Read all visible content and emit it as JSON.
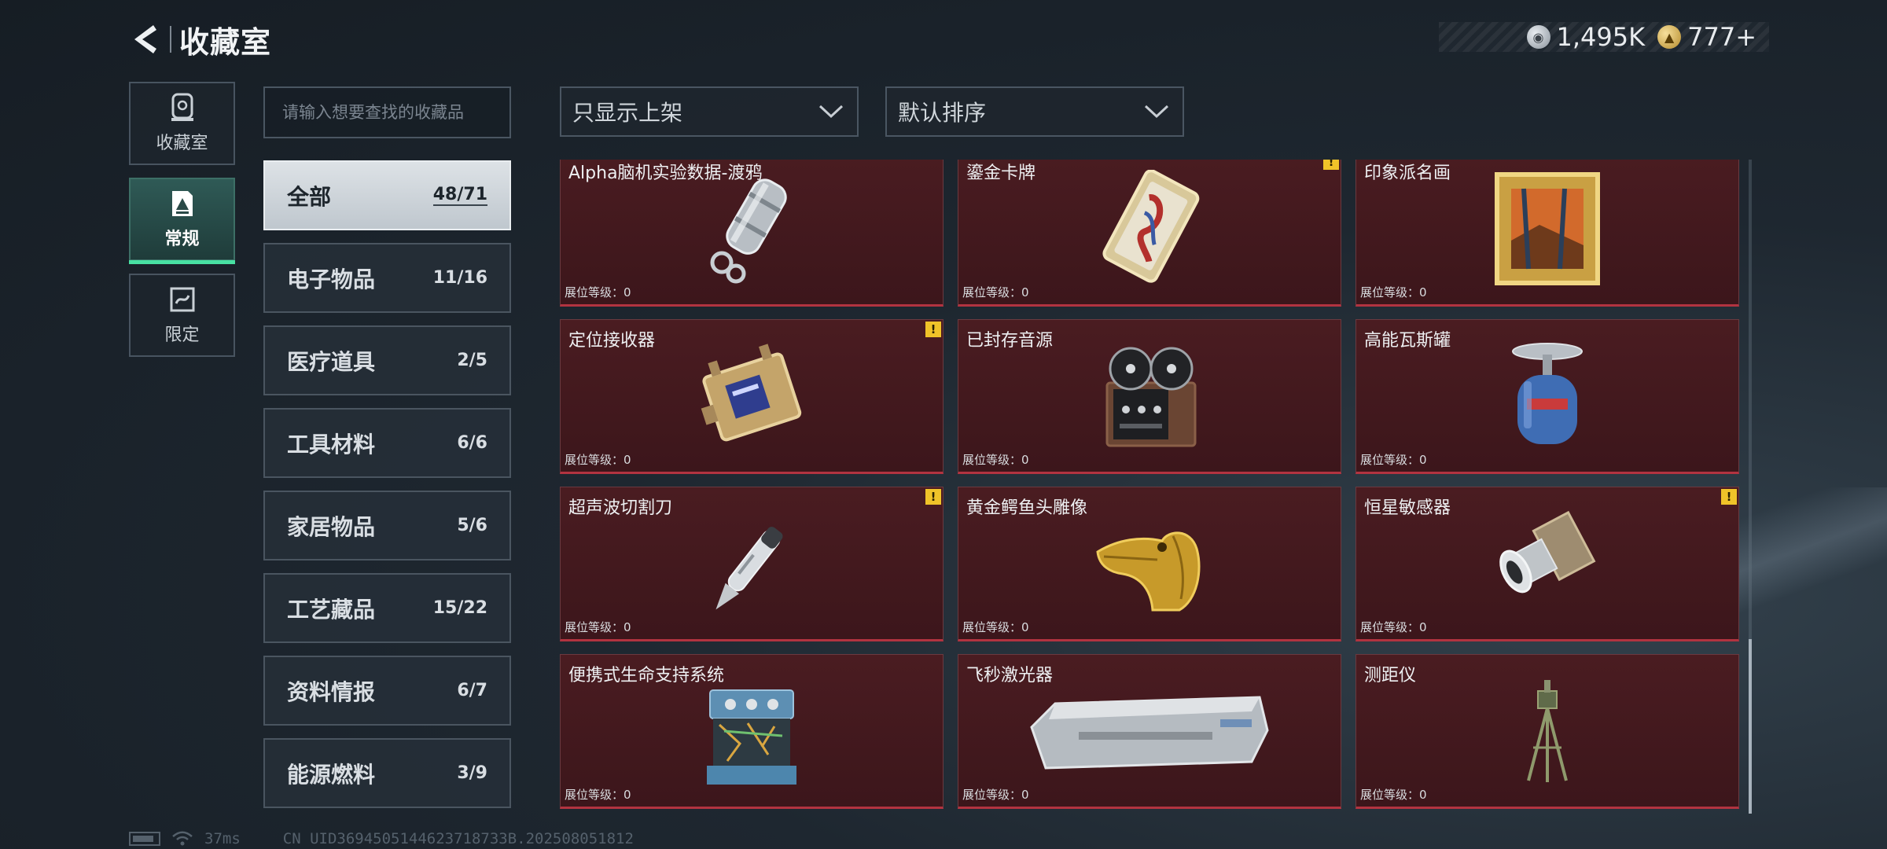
{
  "header": {
    "title": "收藏室"
  },
  "currency": [
    {
      "icon": "silver-coin-icon",
      "value": "1,495K"
    },
    {
      "icon": "gold-coin-icon",
      "value": "777+"
    }
  ],
  "left_nav": [
    {
      "label": "收藏室",
      "icon": "collection-room-icon",
      "active": false
    },
    {
      "label": "常规",
      "icon": "regular-items-icon",
      "active": true
    },
    {
      "label": "限定",
      "icon": "limited-items-icon",
      "active": false
    }
  ],
  "search": {
    "placeholder": "请输入想要查找的收藏品"
  },
  "categories": [
    {
      "name": "全部",
      "count": "48/71",
      "active": true
    },
    {
      "name": "电子物品",
      "count": "11/16"
    },
    {
      "name": "医疗道具",
      "count": "2/5"
    },
    {
      "name": "工具材料",
      "count": "6/6"
    },
    {
      "name": "家居物品",
      "count": "5/6"
    },
    {
      "name": "工艺藏品",
      "count": "15/22"
    },
    {
      "name": "资料情报",
      "count": "6/7"
    },
    {
      "name": "能源燃料",
      "count": "3/9"
    }
  ],
  "filters": {
    "shelf_filter": "只显示上架",
    "sort": "默认排序"
  },
  "items": [
    {
      "name": "Alpha脑机实验数据-渡鸦",
      "level": "展位等级：0",
      "warning": false,
      "art": "data-canister"
    },
    {
      "name": "鎏金卡牌",
      "level": "展位等级：0",
      "warning": true,
      "art": "gilded-card"
    },
    {
      "name": "印象派名画",
      "level": "展位等级：0",
      "warning": false,
      "art": "painting"
    },
    {
      "name": "定位接收器",
      "level": "展位等级：0",
      "warning": true,
      "art": "receiver"
    },
    {
      "name": "已封存音源",
      "level": "展位等级：0",
      "warning": false,
      "art": "tape-recorder"
    },
    {
      "name": "高能瓦斯罐",
      "level": "展位等级：0",
      "warning": false,
      "art": "gas-tank"
    },
    {
      "name": "超声波切割刀",
      "level": "展位等级：0",
      "warning": true,
      "art": "ultrasonic-knife"
    },
    {
      "name": "黄金鳄鱼头雕像",
      "level": "展位等级：0",
      "warning": false,
      "art": "croc-statue"
    },
    {
      "name": "恒星敏感器",
      "level": "展位等级：0",
      "warning": true,
      "art": "star-sensor"
    },
    {
      "name": "便携式生命支持系统",
      "level": "展位等级：0",
      "warning": false,
      "art": "life-support"
    },
    {
      "name": "飞秒激光器",
      "level": "展位等级：0",
      "warning": false,
      "art": "laser-case"
    },
    {
      "name": "测距仪",
      "level": "展位等级：0",
      "warning": false,
      "art": "rangefinder"
    }
  ],
  "status": {
    "ping": "37ms",
    "uid": "CN UID3694505144623718733B.202508051812"
  },
  "colors": {
    "accent": "#48e0a2",
    "card_bg": "#3c161b",
    "card_border": "#b23340",
    "warning": "#f0c329"
  }
}
